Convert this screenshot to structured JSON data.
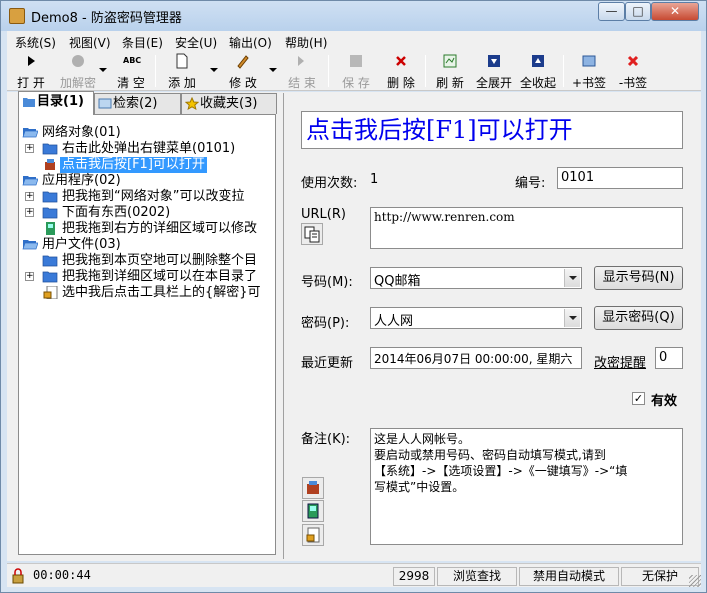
{
  "window": {
    "title": "Demo8 - 防盗密码管理器",
    "controls": {
      "minimize": "—",
      "maximize": "□",
      "close": "✕"
    }
  },
  "menu": [
    "系统(S)",
    "视图(V)",
    "条目(E)",
    "安全(U)",
    "输出(O)",
    "帮助(H)"
  ],
  "toolbar": {
    "open": "打 开",
    "decrypt": "加解密",
    "clear": "清 空",
    "add": "添 加",
    "modify": "修 改",
    "end": "结 束",
    "save": "保 存",
    "delete": "删 除",
    "refresh": "刷 新",
    "expand_all": "全展开",
    "collapse_all": "全收起",
    "add_bookmark": "+书签",
    "remove_bookmark": "-书签",
    "clear_icon_text": "ABC"
  },
  "tabs": [
    "目录(1)",
    "检索(2)",
    "收藏夹(3)"
  ],
  "tree": [
    {
      "label": "网络对象(01)",
      "level": 0,
      "type": "folder-open",
      "expander": false
    },
    {
      "label": "右击此处弹出右键菜单(0101)",
      "level": 1,
      "type": "folder",
      "expander": true
    },
    {
      "label": "点击我后按[F1]可以打开",
      "level": 1,
      "type": "item",
      "expander": false,
      "selected": true
    },
    {
      "label": "应用程序(02)",
      "level": 0,
      "type": "folder-open",
      "expander": false
    },
    {
      "label": "把我拖到“网络对象”可以改变拉",
      "level": 1,
      "type": "folder",
      "expander": true
    },
    {
      "label": "下面有东西(0202)",
      "level": 1,
      "type": "folder",
      "expander": true
    },
    {
      "label": "把我拖到右方的详细区域可以修改",
      "level": 1,
      "type": "item-green",
      "expander": false
    },
    {
      "label": "用户文件(03)",
      "level": 0,
      "type": "folder-open",
      "expander": false
    },
    {
      "label": "把我拖到本页空地可以删除整个目",
      "level": 1,
      "type": "folder",
      "expander": false
    },
    {
      "label": "把我拖到详细区域可以在本目录了",
      "level": 1,
      "type": "folder",
      "expander": true
    },
    {
      "label": "选中我后点击工具栏上的{解密}可",
      "level": 1,
      "type": "item-lock",
      "expander": false
    }
  ],
  "detail": {
    "title": "点击我后按[F1]可以打开",
    "usage_label": "使用次数:",
    "usage_value": "1",
    "number_label": "编号:",
    "number_value": "0101",
    "url_label": "URL(R)",
    "url_value": "http://www.renren.com",
    "account_label": "号码(M):",
    "account_value": "QQ邮箱",
    "show_account_btn": "显示号码(N)",
    "password_label": "密码(P):",
    "password_value": "人人网",
    "show_password_btn": "显示密码(Q)",
    "updated_label": "最近更新",
    "updated_value": "2014年06月07日 00:00:00, 星期六",
    "reminder_link": "改密提醒",
    "reminder_value": "0",
    "valid_label": "有效",
    "valid_checked": "✓",
    "notes_label": "备注(K):",
    "notes": [
      "这是人人网帐号。",
      "要启动或禁用号码、密码自动填写模式,请到",
      "【系统】->【选项设置】->《一键填写》->“填",
      "写模式”中设置。"
    ]
  },
  "status": {
    "timer": "00:00:44",
    "count": "2998",
    "browse": "浏览查找",
    "autofill": "禁用自动模式",
    "protect": "无保护"
  }
}
